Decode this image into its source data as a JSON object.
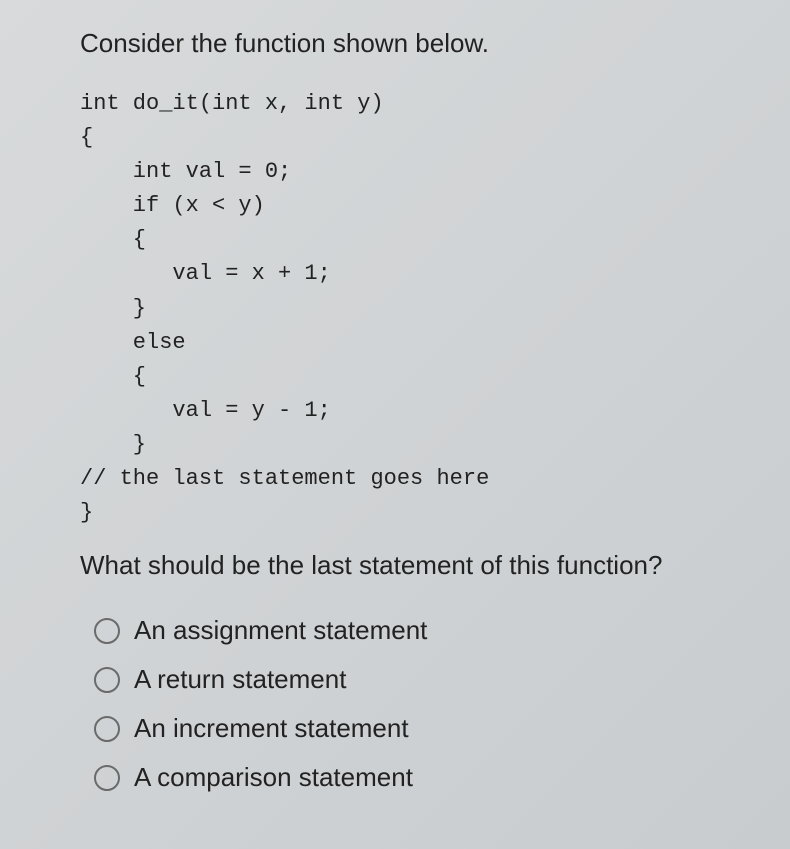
{
  "intro": "Consider the function shown below.",
  "code": "int do_it(int x, int y)\n{\n    int val = 0;\n    if (x < y)\n    {\n       val = x + 1;\n    }\n    else\n    {\n       val = y - 1;\n    }\n// the last statement goes here\n}",
  "question": "What should be the last statement of this function?",
  "options": [
    {
      "label": "An assignment statement"
    },
    {
      "label": "A return statement"
    },
    {
      "label": "An increment statement"
    },
    {
      "label": "A comparison statement"
    }
  ]
}
